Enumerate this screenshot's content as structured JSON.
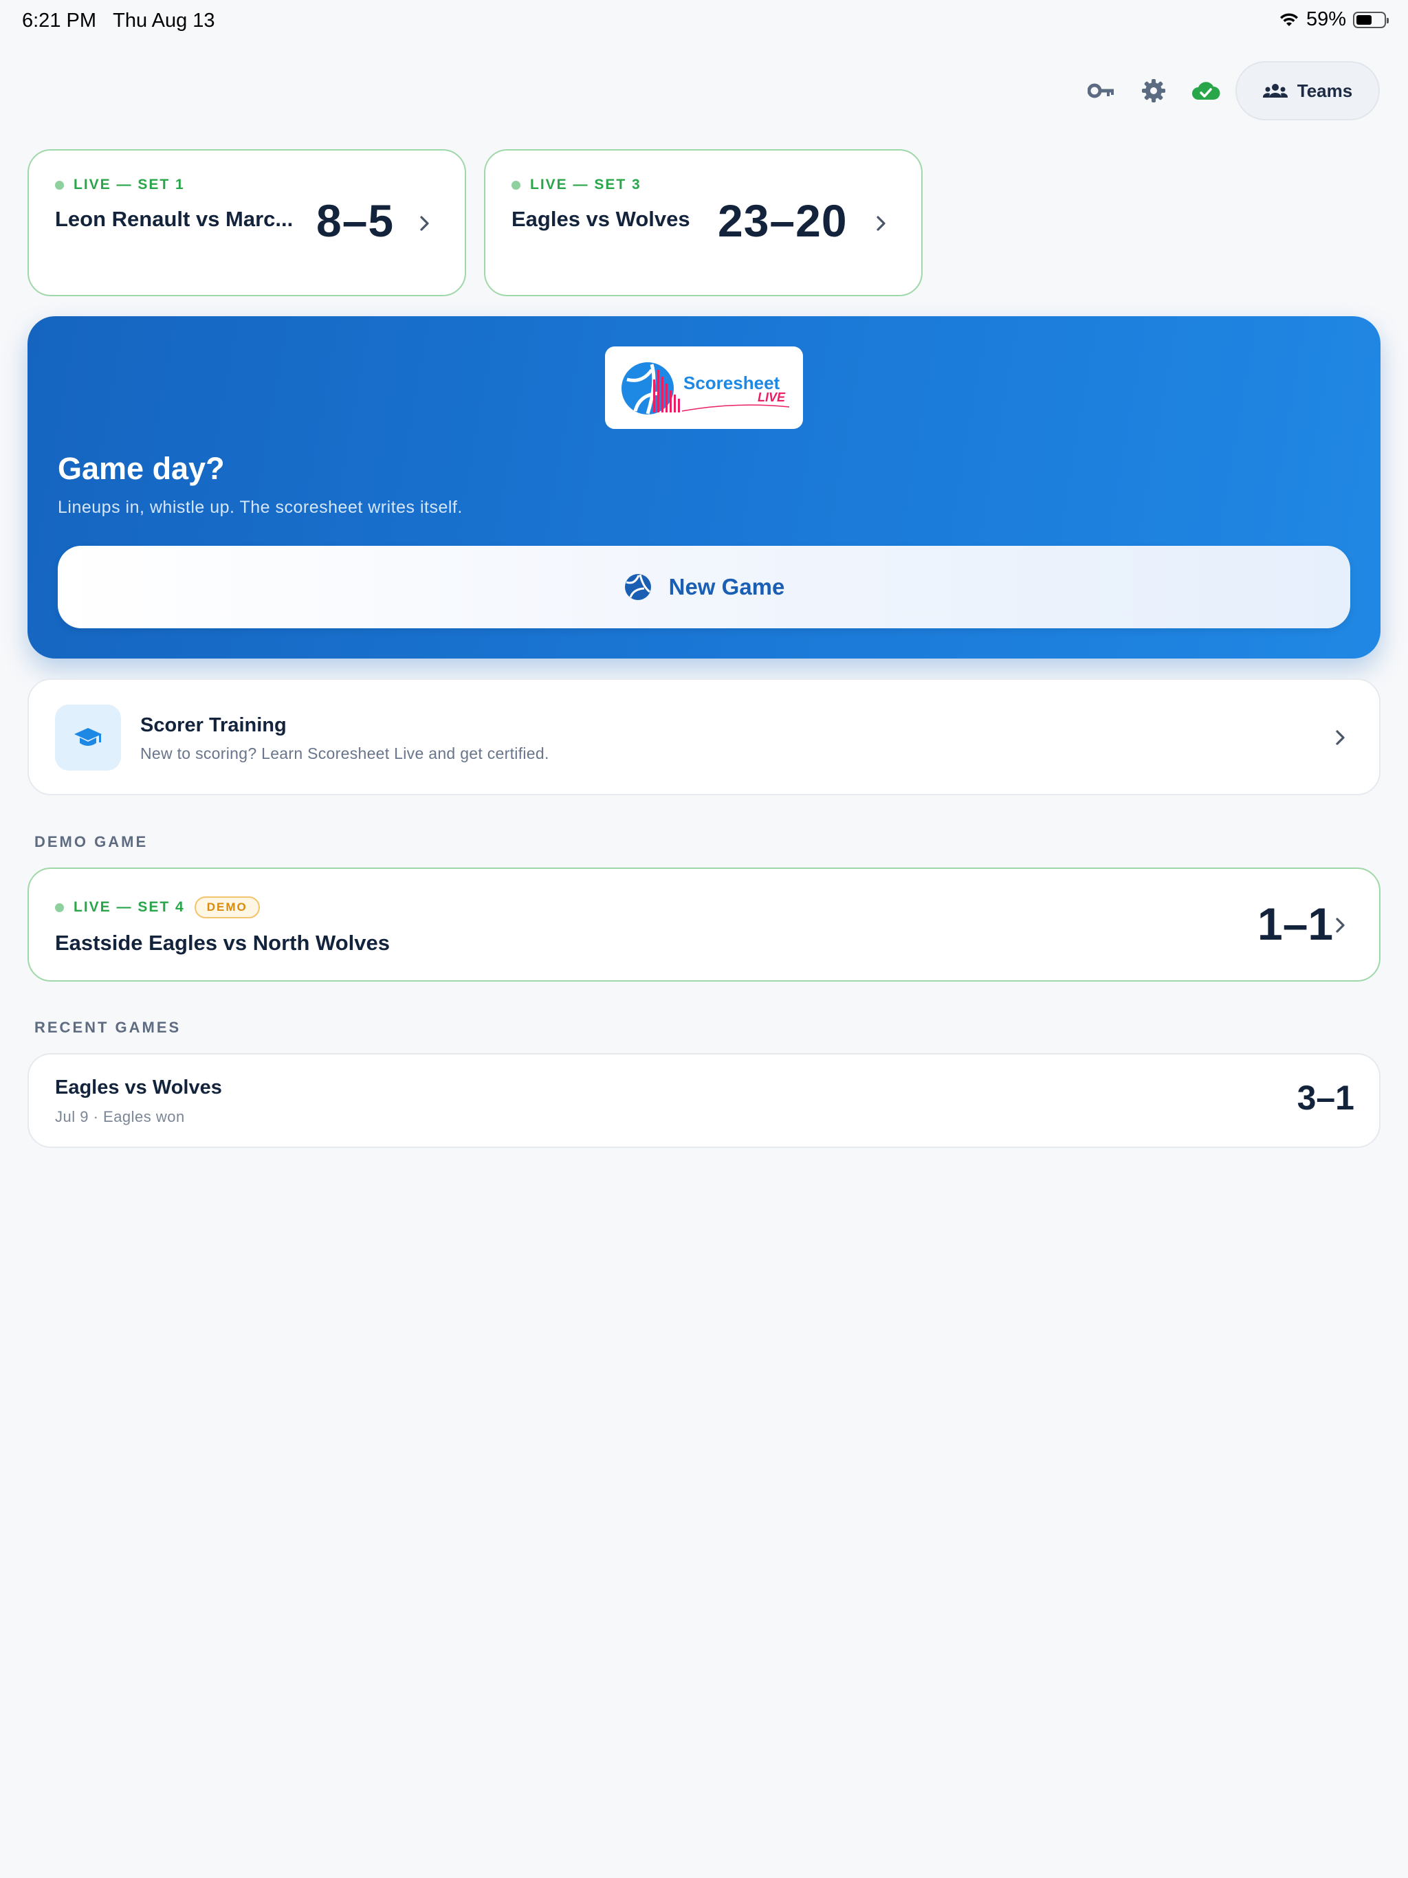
{
  "status_bar": {
    "time": "6:21 PM",
    "date": "Thu Aug 13",
    "battery_text": "59%",
    "battery_level": 0.59
  },
  "toolbar": {
    "key_icon": "key-icon",
    "settings_icon": "gear-icon",
    "cloud_icon": "cloud-check-icon",
    "teams_label": "Teams"
  },
  "live_games": [
    {
      "status": "LIVE — SET 1",
      "teams": "Leon Renault vs Marc...",
      "score": "8–5"
    },
    {
      "status": "LIVE — SET 3",
      "teams": "Eagles vs Wolves",
      "score": "23–20"
    }
  ],
  "hero": {
    "logo_text": "Scoresheet",
    "logo_subtext": "LIVE",
    "title": "Game day?",
    "subtitle": "Lineups in, whistle up. The scoresheet writes itself.",
    "button_label": "New Game"
  },
  "training": {
    "title": "Scorer Training",
    "subtitle": "New to scoring? Learn Scoresheet Live and get certified."
  },
  "demo": {
    "section_title": "DEMO GAME",
    "status": "LIVE — SET 4",
    "badge": "DEMO",
    "teams": "Eastside Eagles vs North Wolves",
    "score": "1–1"
  },
  "recent": {
    "section_title": "RECENT GAMES",
    "games": [
      {
        "teams": "Eagles vs Wolves",
        "meta": "Jul 9 · Eagles won",
        "score": "3–1"
      }
    ]
  },
  "colors": {
    "accent": "#1565c0",
    "live_green": "#2aa64a",
    "background": "#f7f8fa",
    "demo_badge": "#d88b10"
  }
}
